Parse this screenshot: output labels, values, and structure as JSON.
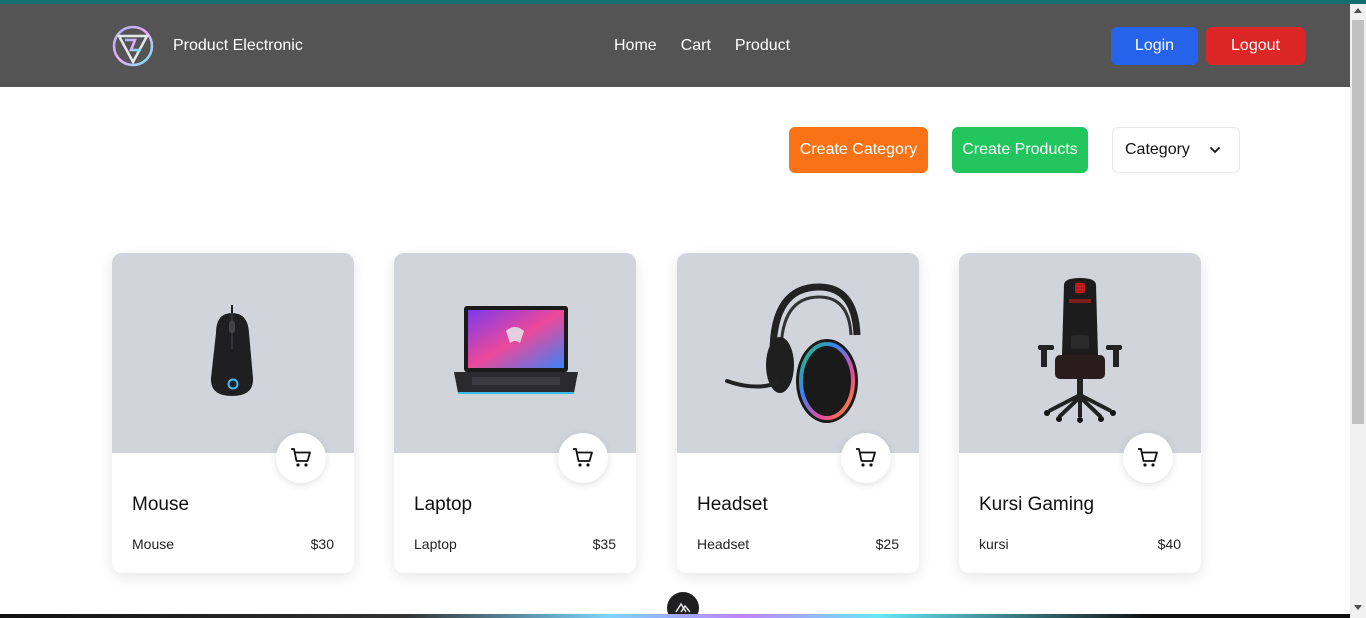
{
  "header": {
    "brand": "Product Electronic",
    "nav": [
      "Home",
      "Cart",
      "Product"
    ],
    "login_label": "Login",
    "logout_label": "Logout"
  },
  "toolbar": {
    "create_category_label": "Create Category",
    "create_products_label": "Create Products",
    "category_select_value": "Category"
  },
  "products": [
    {
      "title": "Mouse",
      "description": "Mouse",
      "price": "$30",
      "image_icon": "mouse-image"
    },
    {
      "title": "Laptop",
      "description": "Laptop",
      "price": "$35",
      "image_icon": "laptop-image"
    },
    {
      "title": "Headset",
      "description": "Headset",
      "price": "$25",
      "image_icon": "headset-image"
    },
    {
      "title": "Kursi Gaming",
      "description": "kursi",
      "price": "$40",
      "image_icon": "gaming-chair-image"
    }
  ],
  "colors": {
    "navbar": "#545454",
    "login": "#2563eb",
    "logout": "#dc2626",
    "create_category": "#f97316",
    "create_products": "#22c55e",
    "card_image_bg": "#d1d5db"
  }
}
